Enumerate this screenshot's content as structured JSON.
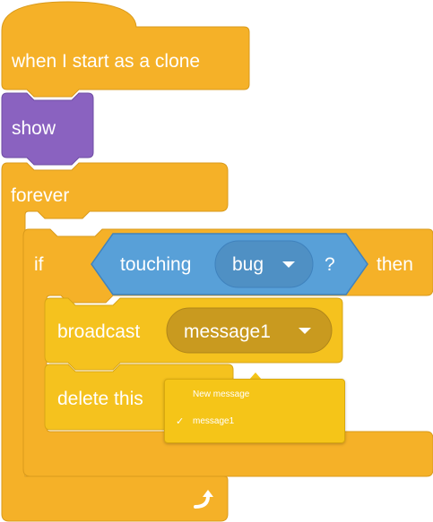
{
  "blocks": {
    "hat": {
      "label": "when I start as a clone",
      "color": "#f5b128"
    },
    "show": {
      "label": "show",
      "color": "#8a62c0"
    },
    "forever": {
      "label": "forever",
      "color": "#f5b128"
    },
    "if": {
      "label": "if",
      "then_label": "then",
      "color": "#f5b128",
      "condition": {
        "label": "touching",
        "target": "bug",
        "suffix": "?",
        "color": "#58a0d8",
        "dropdown_color": "#4f90c4"
      }
    },
    "broadcast": {
      "label": "broadcast",
      "value": "message1",
      "color": "#f5c21e",
      "dropdown_color": "#c99a1f"
    },
    "delete": {
      "label": "delete this",
      "color": "#f5c21e"
    }
  },
  "dropdown_menu": {
    "items": [
      {
        "label": "New message",
        "checked": false
      },
      {
        "label": "message1",
        "checked": true
      }
    ],
    "check_symbol": "✓",
    "color": "#f5c518"
  },
  "icons": {
    "loop_arrow": "loop-arrow-icon"
  }
}
